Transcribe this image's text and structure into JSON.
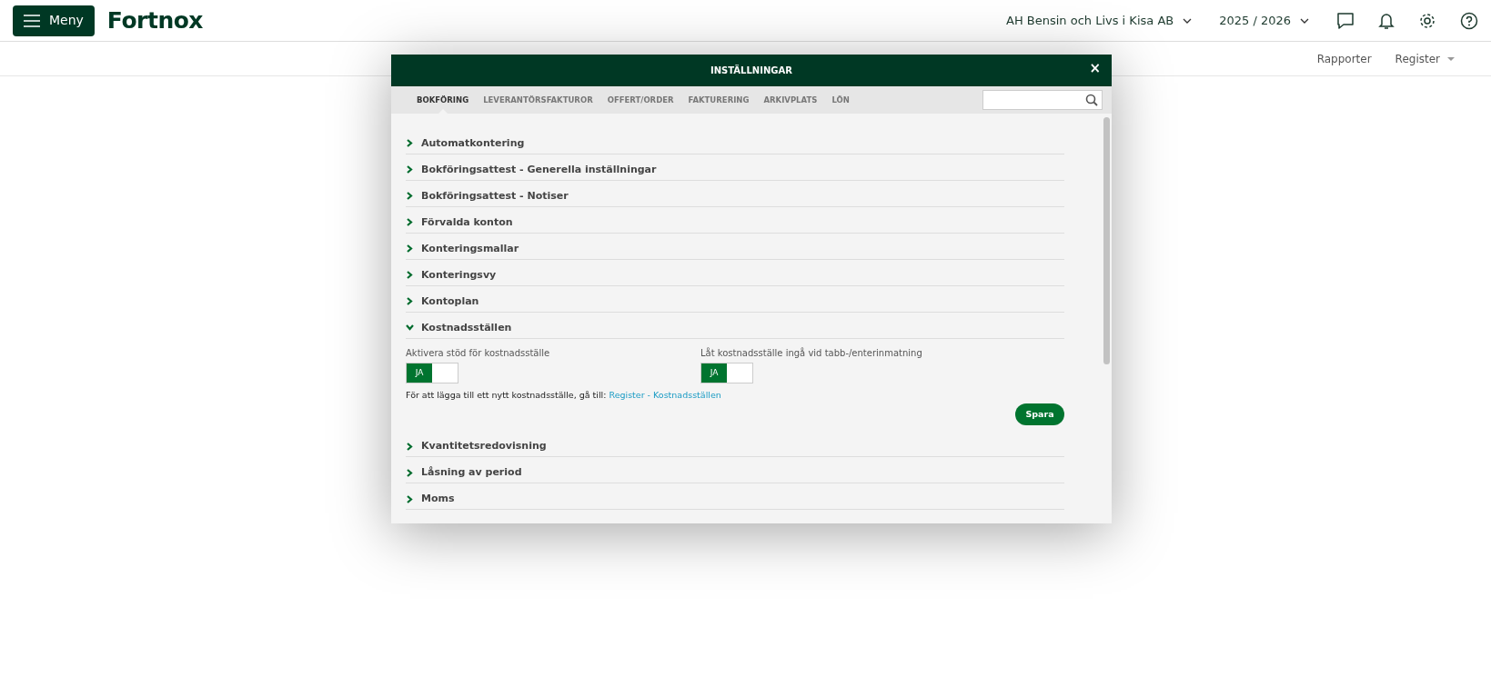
{
  "topbar": {
    "menu_button": "Meny",
    "logo": "Fortnox",
    "company": "AH Bensin och Livs i Kisa AB",
    "year": "2025 / 2026"
  },
  "subnav": [
    "Rapporter",
    "Register"
  ],
  "modal": {
    "title": "INSTÄLLNINGAR",
    "close": "×",
    "tabs": [
      {
        "label": "BOKFÖRING",
        "selected": true
      },
      {
        "label": "LEVERANTÖRSFAKTUROR",
        "selected": false
      },
      {
        "label": "OFFERT/ORDER",
        "selected": false
      },
      {
        "label": "FAKTURERING",
        "selected": false
      },
      {
        "label": "ARKIVPLATS",
        "selected": false
      },
      {
        "label": "LÖN",
        "selected": false
      }
    ],
    "sections": [
      {
        "title": "Automatkontering",
        "expanded": false
      },
      {
        "title": "Bokföringsattest - Generella inställningar",
        "expanded": false
      },
      {
        "title": "Bokföringsattest - Notiser",
        "expanded": false
      },
      {
        "title": "Förvalda konton",
        "expanded": false
      },
      {
        "title": "Konteringsmallar",
        "expanded": false
      },
      {
        "title": "Konteringsvy",
        "expanded": false
      },
      {
        "title": "Kontoplan",
        "expanded": false
      },
      {
        "title": "Kostnadsställen",
        "expanded": true,
        "content": {
          "toggles": [
            {
              "label": "Aktivera stöd för kostnadsställe",
              "text": "JA",
              "on": true
            },
            {
              "label": "Låt kostnadsställe ingå vid tabb-/enterinmatning",
              "text": "JA",
              "on": true
            }
          ],
          "hint": "För att lägga till ett nytt kostnadsställe, gå till:",
          "link": "Register - Kostnadsställen",
          "save": "Spara"
        }
      },
      {
        "title": "Kvantitetsredovisning",
        "expanded": false
      },
      {
        "title": "Låsning av period",
        "expanded": false
      },
      {
        "title": "Moms",
        "expanded": false
      }
    ]
  }
}
